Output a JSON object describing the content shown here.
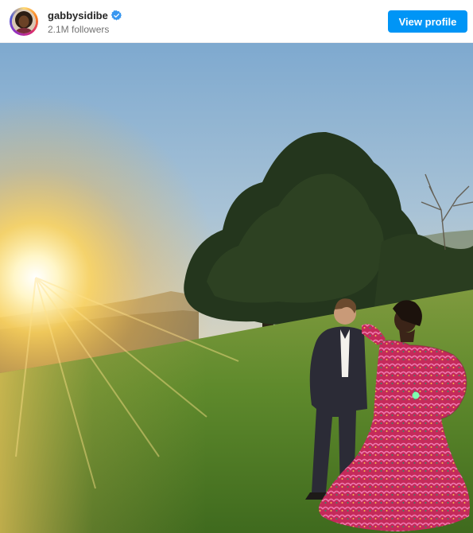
{
  "header": {
    "username": "gabbysidibe",
    "followers": "2.1M followers",
    "view_profile_label": "View profile"
  },
  "icons": {
    "verified": "verified-badge-icon",
    "avatar": "profile-photo"
  },
  "colors": {
    "button_bg": "#0095f6",
    "verified": "#3897f0",
    "username": "#262626",
    "secondary": "#737373"
  }
}
